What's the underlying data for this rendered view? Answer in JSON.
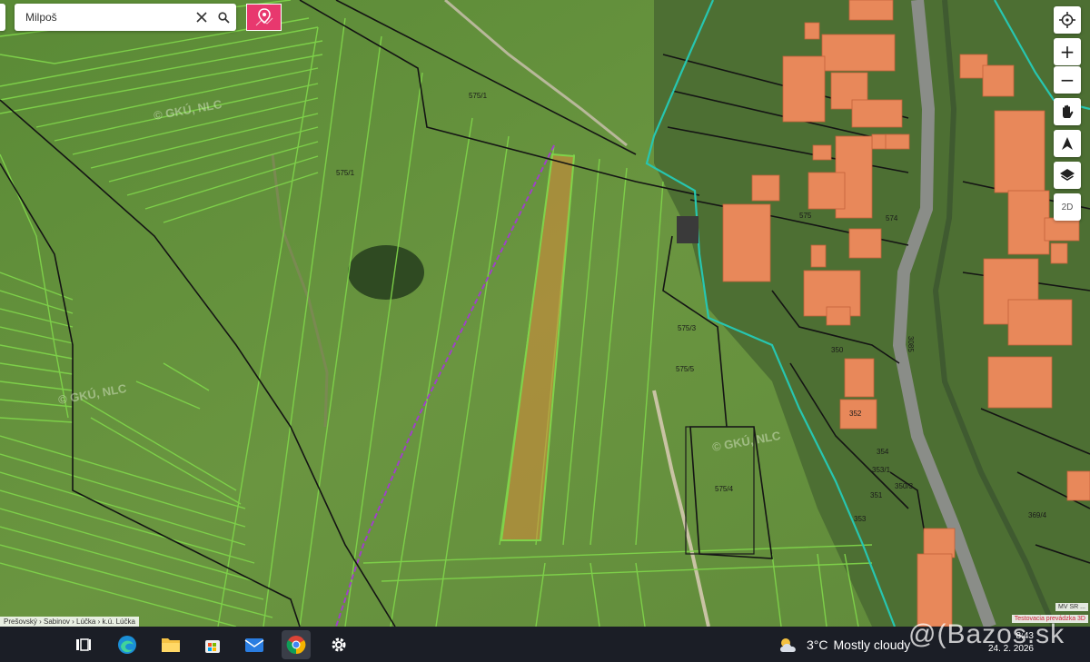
{
  "search": {
    "value": "Milpoš"
  },
  "controls": {
    "zoom_in": "+",
    "zoom_out": "−",
    "mode_2d": "2D"
  },
  "map": {
    "parcel_labels": [
      "575/1",
      "575/3",
      "575/4",
      "575/1",
      "575/5",
      "350",
      "352",
      "350/3",
      "353",
      "354",
      "351",
      "353/1",
      "574",
      "575",
      "369/4"
    ],
    "watermarks": [
      "© GKÚ, NLC",
      "© GKÚ, NLC",
      "© GKÚ, NLC"
    ],
    "road_label": "3085",
    "colors": {
      "parcel_line": "#7fd34a",
      "boundary_line": "#141414",
      "municipal_boundary": "#27c6b0",
      "selected_parcel": "#d88a3a",
      "building": "#e8885a",
      "power_line": "#a040c8"
    }
  },
  "breadcrumb": "Prešovský › Sabinov › Lúčka › k.ú. Lúčka",
  "attribution": {
    "line1": "MV SR ...",
    "line2": "Testovacia prevádzka 3D"
  },
  "taskbar": {
    "weather_temp": "3°C",
    "weather_desc": "Mostly cloudy",
    "time": "8:43",
    "date": "24. 2. 2026"
  },
  "watermark_brand": "@(Bazos.sk"
}
